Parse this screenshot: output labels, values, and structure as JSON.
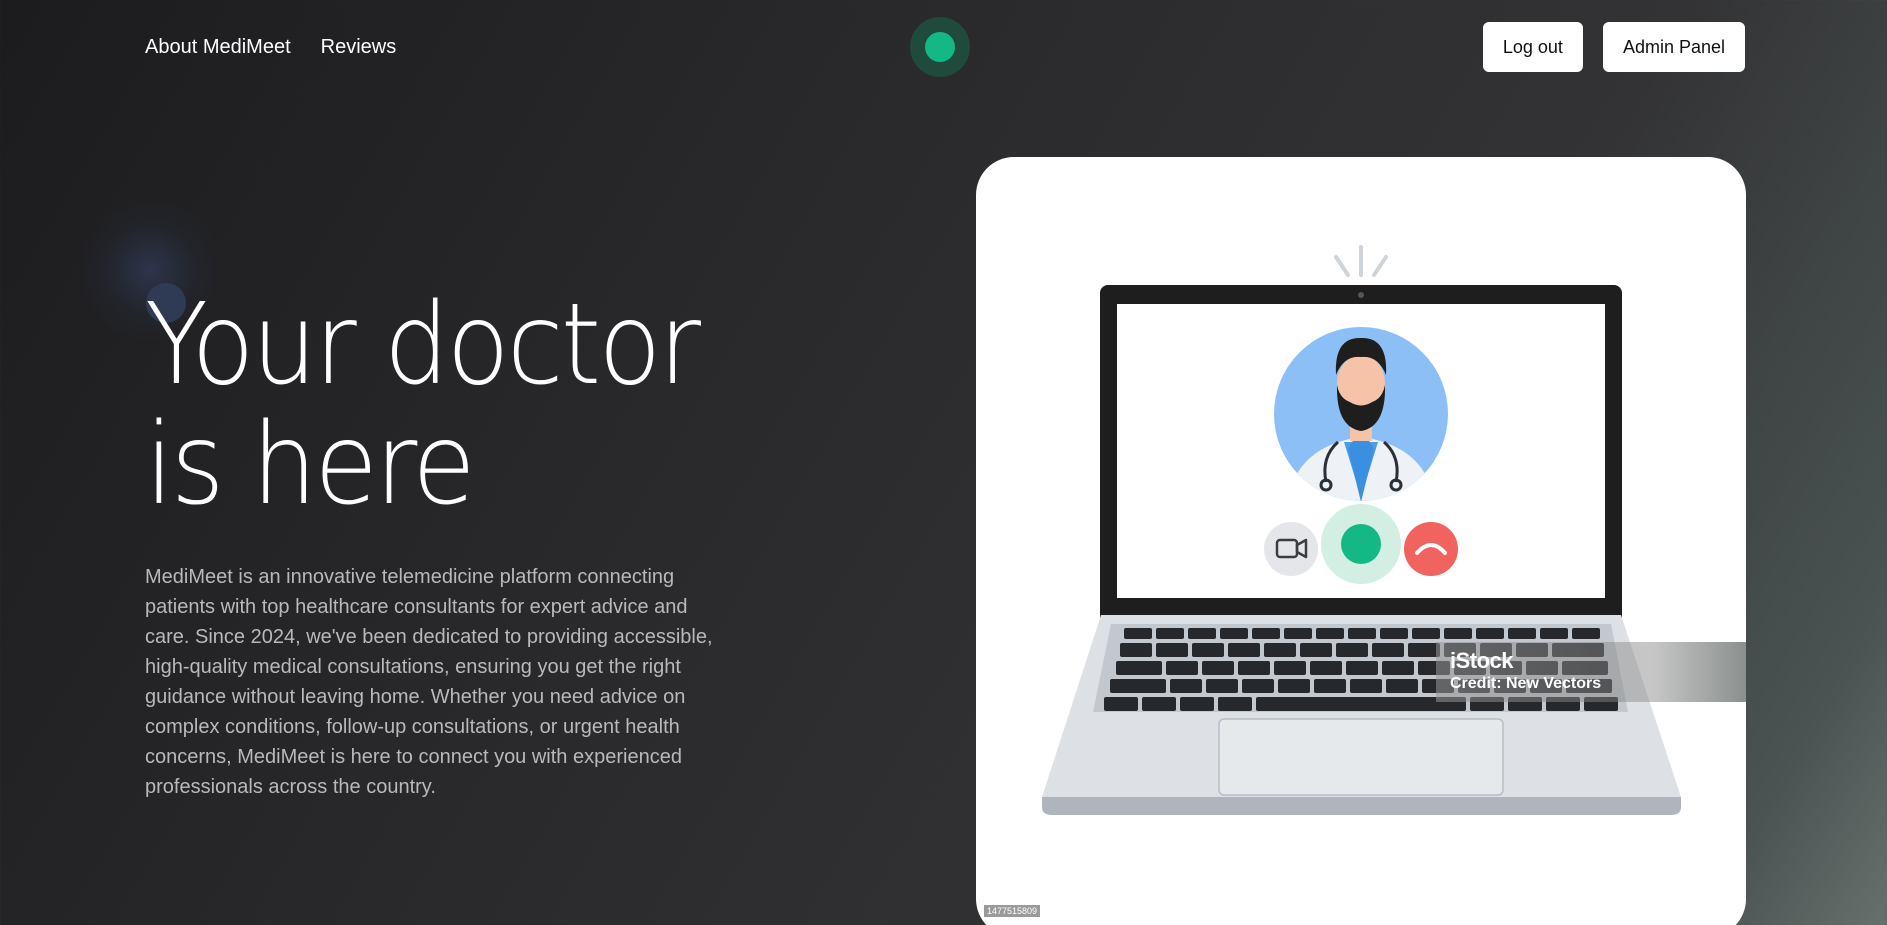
{
  "nav": {
    "links": [
      "About MediMeet",
      "Reviews"
    ],
    "buttons": [
      "Log out",
      "Admin Panel"
    ]
  },
  "hero": {
    "title_lines": [
      "Your doctor",
      "is here"
    ],
    "description": "MediMeet is an innovative telemedicine platform connecting patients with top healthcare consultants for expert advice and care. Since 2024, we've been dedicated to providing accessible, high-quality medical consultations, ensuring you get the right guidance without leaving home. Whether you need advice on complex conditions, follow-up consultations, or urgent health concerns, MediMeet is here to connect you with experienced professionals across the country."
  },
  "image": {
    "watermark_brand": "iStock",
    "watermark_credit": "Credit: New Vectors",
    "image_id": "1477515809"
  },
  "colors": {
    "accent": "#14b885",
    "end_call": "#f0635e",
    "avatar_bg": "#8cbff5"
  },
  "icons": [
    "video-camera-icon",
    "call-icon",
    "hang-up-icon",
    "stethoscope-icon"
  ]
}
